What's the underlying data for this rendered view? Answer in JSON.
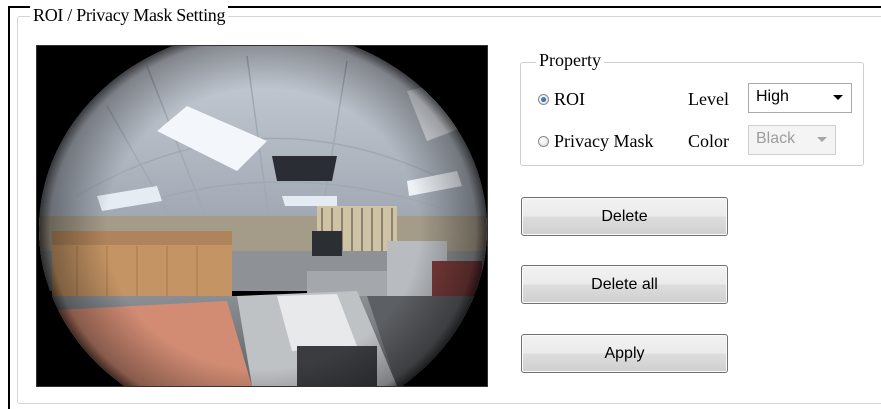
{
  "group": {
    "title": "ROI / Privacy Mask Setting"
  },
  "property": {
    "title": "Property",
    "roi_label": "ROI",
    "privacy_label": "Privacy Mask",
    "roi_checked": true,
    "level_label": "Level",
    "level_value": "High",
    "color_label": "Color",
    "color_value": "Black",
    "color_disabled": true
  },
  "buttons": {
    "delete": "Delete",
    "delete_all": "Delete all",
    "apply": "Apply"
  },
  "colors": {
    "radio_selected": "#1b4f9a",
    "disabled_text": "#9d9d9d"
  }
}
